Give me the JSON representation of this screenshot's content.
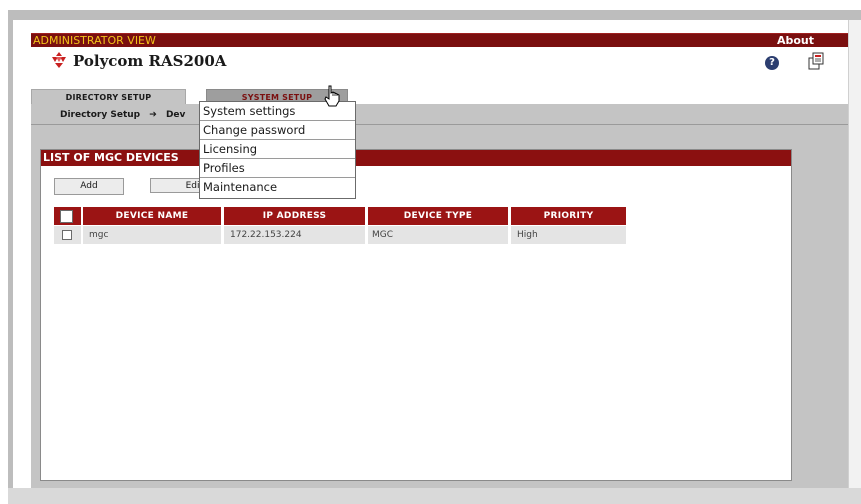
{
  "header": {
    "admin_label": "ADMINISTRATOR VIEW",
    "about_label": "About",
    "product_name": "Polycom RAS200A",
    "accent_color": "#7a0f0f",
    "admin_label_color": "#f2c21a"
  },
  "icons": {
    "logo": "polycom-logo-icon",
    "help": "help-icon",
    "docs": "documents-icon",
    "cursor": "hand-pointer-cursor"
  },
  "tabs": [
    {
      "label": "DIRECTORY SETUP",
      "active": true
    },
    {
      "label": "SYSTEM SETUP",
      "active": false
    }
  ],
  "breadcrumb": {
    "root": "Directory Setup",
    "current": "Dev"
  },
  "dropdown": {
    "items": [
      "System settings",
      "Change password",
      "Licensing",
      "Profiles",
      "Maintenance"
    ]
  },
  "panel": {
    "title": "LIST OF MGC DEVICES",
    "buttons": {
      "add": "Add",
      "edit": "Edit"
    },
    "columns": [
      "DEVICE NAME",
      "IP ADDRESS",
      "DEVICE TYPE",
      "PRIORITY"
    ],
    "rows": [
      {
        "name": "mgc",
        "ip": "172.22.153.224",
        "type": "MGC",
        "priority": "High"
      }
    ]
  }
}
